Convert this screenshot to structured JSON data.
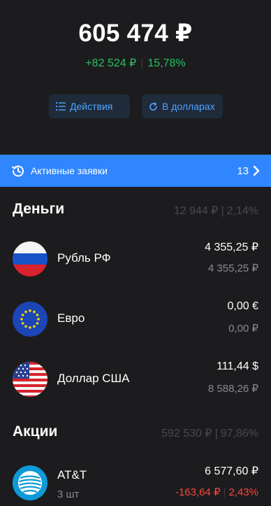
{
  "header": {
    "total": "605 474 ₽",
    "gain_amount": "+82 524 ₽",
    "gain_percent": "15,78%",
    "actions_label": "Действия",
    "currency_toggle_label": "В долларах"
  },
  "orders_banner": {
    "label": "Активные заявки",
    "count": "13"
  },
  "money": {
    "title": "Деньги",
    "total": "12 944 ₽",
    "percent": "2,14%",
    "items": [
      {
        "name": "Рубль РФ",
        "value": "4 355,25 ₽",
        "value_rub": "4 355,25 ₽",
        "flag": "russia-flag-icon"
      },
      {
        "name": "Евро",
        "value": "0,00 €",
        "value_rub": "0,00 ₽",
        "flag": "eu-flag-icon"
      },
      {
        "name": "Доллар США",
        "value": "111,44 $",
        "value_rub": "8 588,26 ₽",
        "flag": "usa-flag-icon"
      }
    ]
  },
  "stocks": {
    "title": "Акции",
    "total": "592 530 ₽",
    "percent": "97,86%",
    "items": [
      {
        "name": "AT&T",
        "quantity": "3 шт",
        "value": "6 577,60 ₽",
        "change": "-163,64 ₽",
        "change_percent": "2,43%",
        "logo": "att-logo-icon"
      }
    ]
  },
  "colors": {
    "background": "#1c1c1e",
    "accent": "#2f86ff",
    "positive": "#27c062",
    "negative": "#ff453a",
    "button_bg": "#1f2b3b"
  }
}
